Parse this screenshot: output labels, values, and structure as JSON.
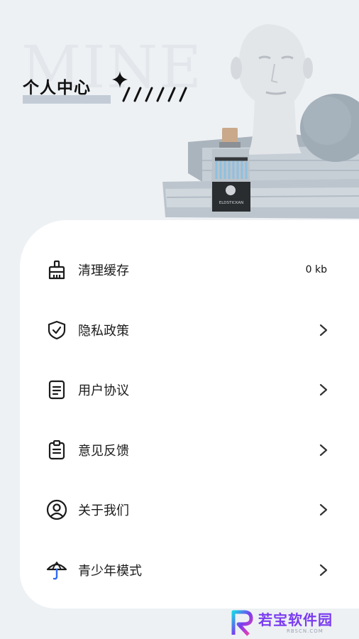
{
  "header": {
    "watermark": "MINE",
    "title": "个人中心"
  },
  "menu": [
    {
      "label": "清理缓存",
      "value": "0 kb",
      "icon": "broom-icon"
    },
    {
      "label": "隐私政策",
      "icon": "shield-check-icon"
    },
    {
      "label": "用户协议",
      "icon": "document-icon"
    },
    {
      "label": "意见反馈",
      "icon": "clipboard-icon"
    },
    {
      "label": "关于我们",
      "icon": "user-circle-icon"
    },
    {
      "label": "青少年模式",
      "icon": "umbrella-icon"
    }
  ],
  "bottle_label": "ELDSTICKAN",
  "logo": {
    "brand": "若宝软件园",
    "site": "RBSCN.COM"
  },
  "colors": {
    "background": "#eef1f4",
    "card": "#ffffff",
    "title_highlight": "#c3ccd6",
    "umbrella_accent": "#2f6cf0",
    "logo_purple": "#7a3cf0"
  }
}
